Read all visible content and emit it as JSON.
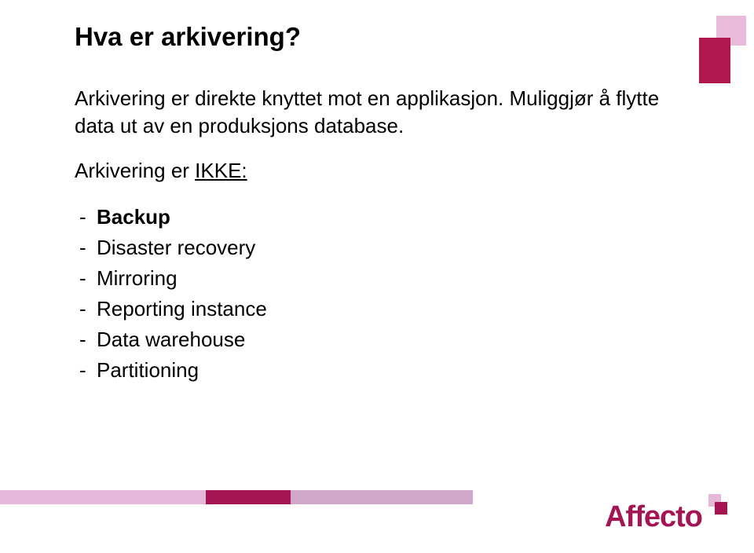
{
  "title": "Hva er arkivering?",
  "paragraph1": "Arkivering er direkte knyttet mot en applikasjon. Muliggjør å flytte data ut av en produksjons database.",
  "paragraph2_prefix": "Arkivering er ",
  "paragraph2_underlined": "IKKE:",
  "list_items": [
    {
      "text": "Backup",
      "bold": true
    },
    {
      "text": "Disaster recovery",
      "bold": false
    },
    {
      "text": "Mirroring",
      "bold": false
    },
    {
      "text": "Reporting instance",
      "bold": false
    },
    {
      "text": "Data warehouse",
      "bold": false
    },
    {
      "text": "Partitioning",
      "bold": false
    }
  ],
  "logo_text": "Affecto"
}
